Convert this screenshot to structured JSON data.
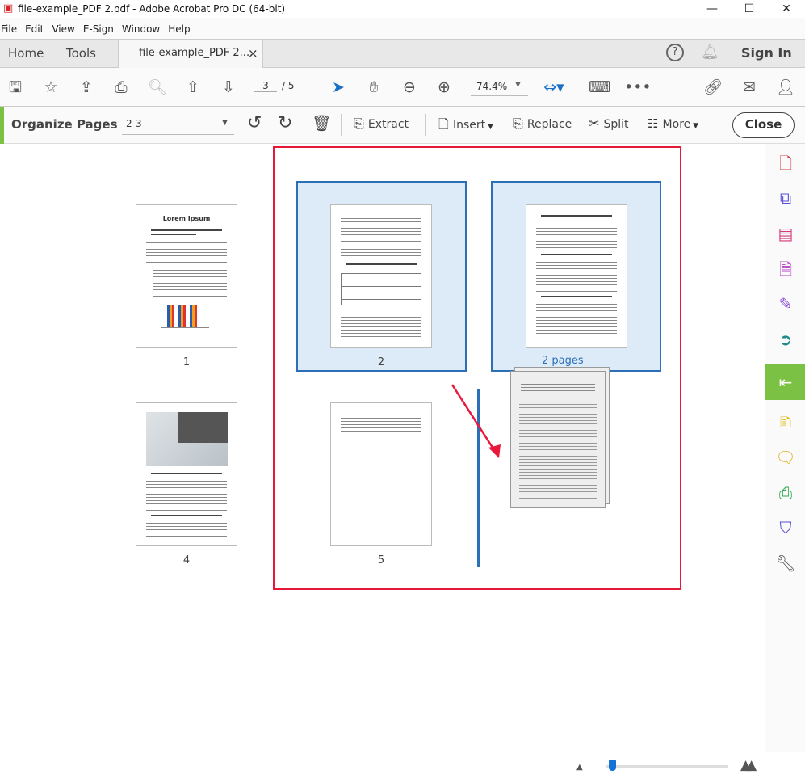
{
  "window": {
    "title": "file-example_PDF 2.pdf - Adobe Acrobat Pro DC (64-bit)",
    "minimize": "—",
    "maximize": "☐",
    "close": "✕"
  },
  "menu": [
    "File",
    "Edit",
    "View",
    "E-Sign",
    "Window",
    "Help"
  ],
  "tabs": {
    "home": "Home",
    "tools": "Tools",
    "document": "file-example_PDF 2....",
    "doc_close": "×",
    "sign_in": "Sign In"
  },
  "toolbar": {
    "current_page": "3",
    "total_pages": "/ 5",
    "zoom": "74.4%"
  },
  "organize": {
    "title": "Organize Pages",
    "page_range": "2-3",
    "extract": "Extract",
    "insert": "Insert",
    "replace": "Replace",
    "split": "Split",
    "more": "More",
    "close": "Close"
  },
  "pages": {
    "p1": {
      "label": "1",
      "title": "Lorem Ipsum"
    },
    "p2": {
      "label": "2"
    },
    "p3": {
      "label": "2 pages"
    },
    "p4": {
      "label": "4"
    },
    "p5": {
      "label": "5"
    }
  },
  "colors": {
    "selection_border": "#2a6fb7",
    "selection_fill": "#dcebf7",
    "annotation_red": "#e8183a",
    "accent_green": "#7bc143"
  },
  "zoom_slider": {
    "level_percent": 5
  }
}
